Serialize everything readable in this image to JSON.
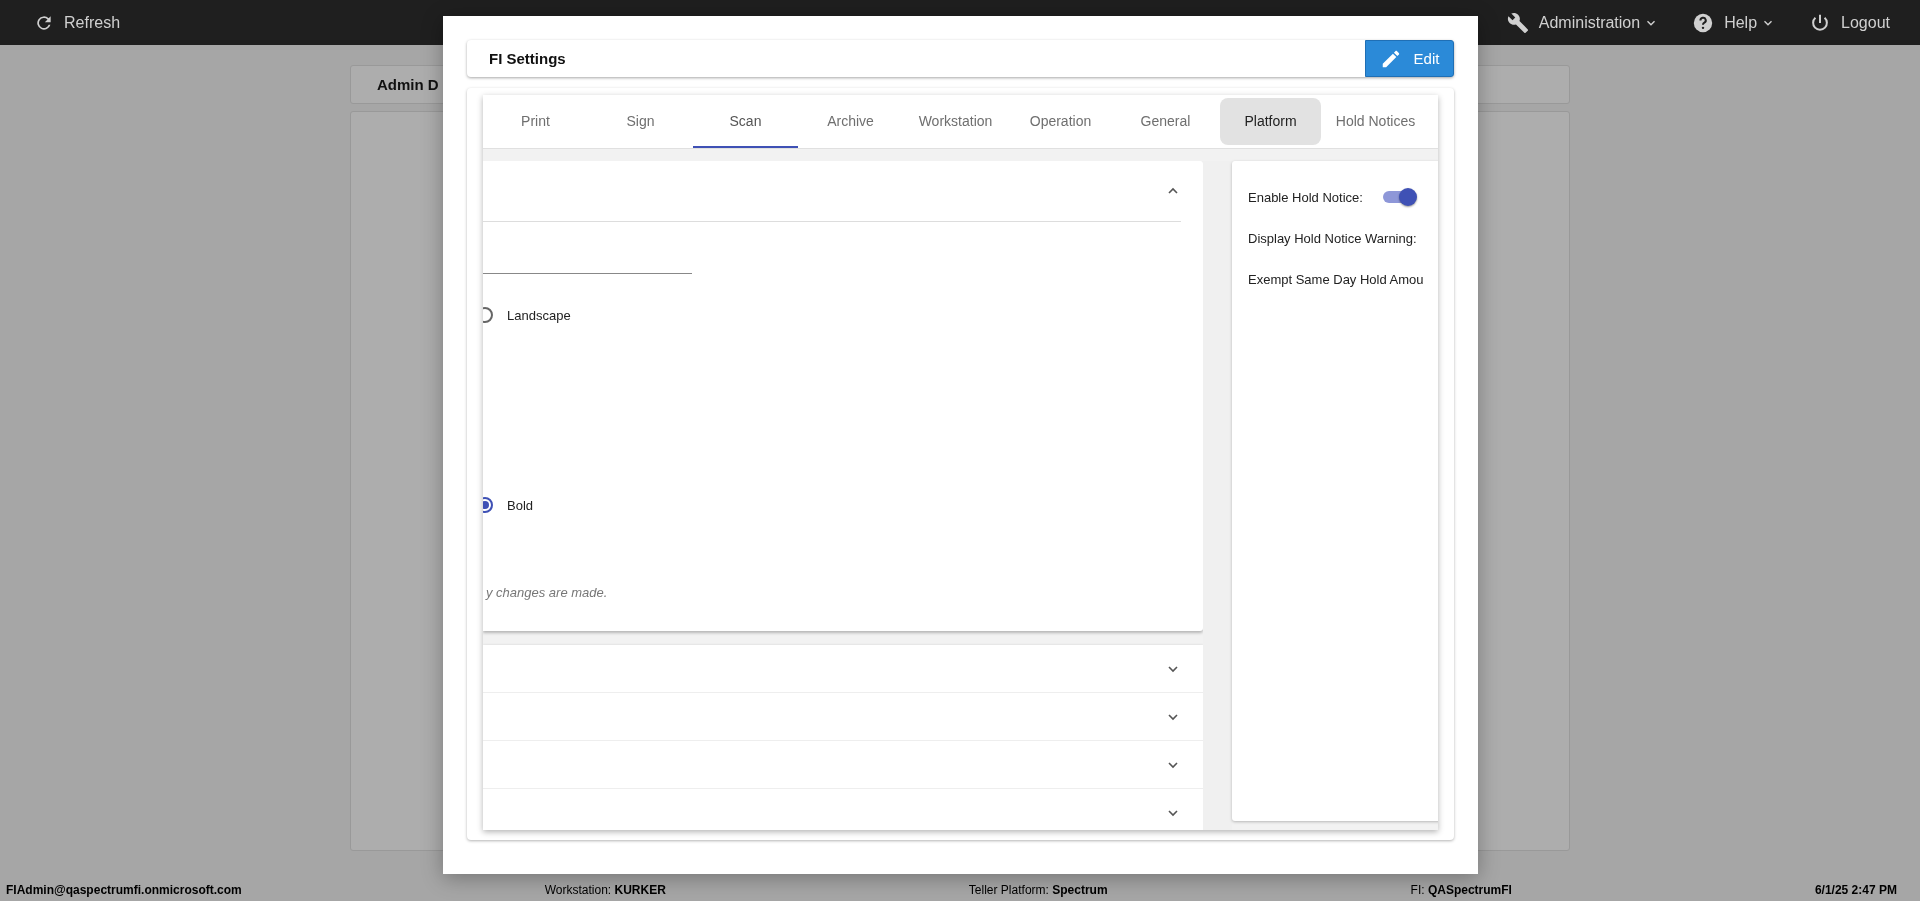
{
  "top_bar": {
    "refresh": "Refresh",
    "menus": [
      {
        "label": "Administration",
        "dropdown": true
      },
      {
        "label": "Help",
        "dropdown": true
      },
      {
        "label": "Logout",
        "dropdown": false
      }
    ]
  },
  "background": {
    "panel_title": "Admin D"
  },
  "modal": {
    "title": "FI Settings",
    "edit_button": "Edit",
    "tabs": [
      {
        "label": "Print",
        "selected": false,
        "highlighted": false
      },
      {
        "label": "Sign",
        "selected": false,
        "highlighted": false
      },
      {
        "label": "Scan",
        "selected": true,
        "highlighted": false
      },
      {
        "label": "Archive",
        "selected": false,
        "highlighted": false
      },
      {
        "label": "Workstation",
        "selected": false,
        "highlighted": false
      },
      {
        "label": "Operation",
        "selected": false,
        "highlighted": false
      },
      {
        "label": "General",
        "selected": false,
        "highlighted": false
      },
      {
        "label": "Platform",
        "selected": false,
        "highlighted": true
      },
      {
        "label": "Hold Notices",
        "selected": false,
        "highlighted": false
      }
    ],
    "scan_section": {
      "expanded": true,
      "orientation_options": [
        {
          "label": "Landscape",
          "selected": false
        }
      ],
      "font_options": [
        {
          "label": "Bold",
          "selected": true
        }
      ],
      "note": "y changes are made."
    },
    "collapsed_sections": [
      {
        "expanded": false
      },
      {
        "expanded": false
      },
      {
        "expanded": false
      },
      {
        "expanded": false
      }
    ],
    "hold_notices": [
      {
        "label": "Enable Hold Notice:",
        "kind": "toggle",
        "on": true
      },
      {
        "label": "Display Hold Notice Warning:",
        "kind": "text"
      },
      {
        "label": "Exempt Same Day Hold Amou",
        "kind": "text"
      }
    ]
  },
  "status_bar": {
    "user": "FIAdmin@qaspectrumfi.onmicrosoft.com",
    "items": [
      "Workstation: **KURKER**",
      "Teller Platform: **Spectrum**",
      "FI: **QASpectrumFI**"
    ],
    "datetime": "6/1/25 2:47 PM"
  }
}
